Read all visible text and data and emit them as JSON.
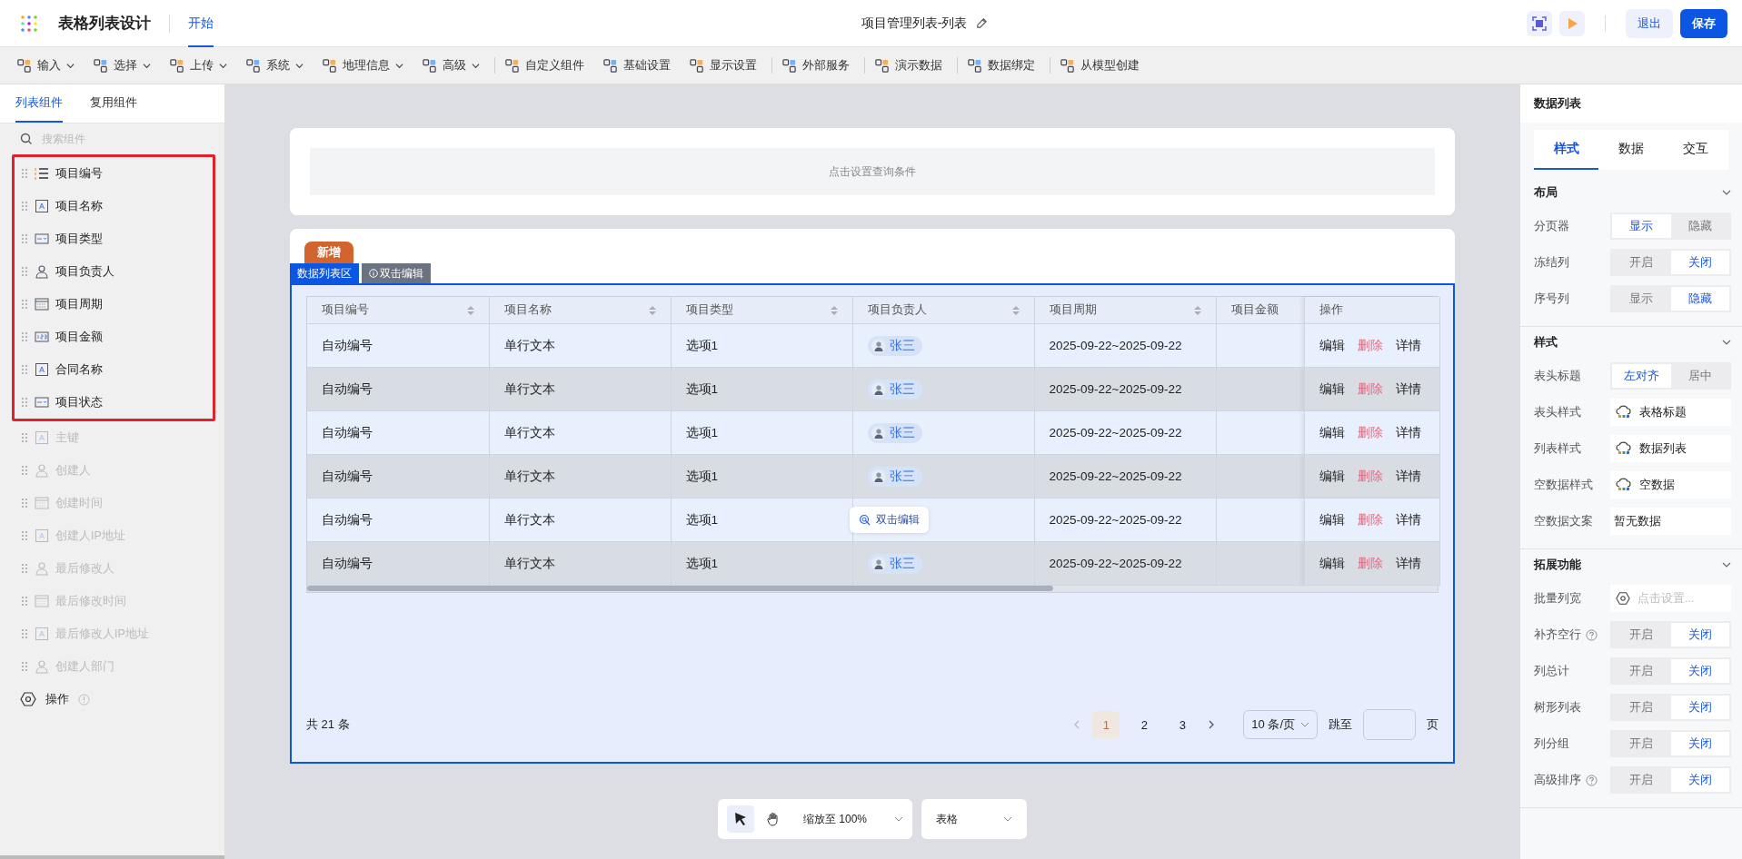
{
  "header": {
    "app_title": "表格列表设计",
    "tabs": [
      {
        "label": "开始",
        "selected": true
      }
    ],
    "doc_title": "项目管理列表-列表",
    "buttons": [
      {
        "label": "退出",
        "kind": "secondary"
      },
      {
        "label": "保存",
        "kind": "primary"
      }
    ]
  },
  "toolbar": [
    {
      "label": "输入",
      "dropdown": true,
      "divider": false
    },
    {
      "label": "选择",
      "dropdown": true,
      "divider": false
    },
    {
      "label": "上传",
      "dropdown": true,
      "divider": false
    },
    {
      "label": "系统",
      "dropdown": true,
      "divider": false
    },
    {
      "label": "地理信息",
      "dropdown": true,
      "divider": false
    },
    {
      "label": "高级",
      "dropdown": true,
      "divider": false
    },
    {
      "label": "自定义组件",
      "dropdown": false,
      "divider": true
    },
    {
      "label": "基础设置",
      "dropdown": false,
      "divider": false
    },
    {
      "label": "显示设置",
      "dropdown": false,
      "divider": false
    },
    {
      "label": "外部服务",
      "dropdown": false,
      "divider": true
    },
    {
      "label": "演示数据",
      "dropdown": false,
      "divider": true
    },
    {
      "label": "数据绑定",
      "dropdown": false,
      "divider": true
    },
    {
      "label": "从模型创建",
      "dropdown": false,
      "divider": true
    }
  ],
  "sidebar": {
    "tabs": [
      {
        "label": "列表组件",
        "selected": true
      },
      {
        "label": "复用组件",
        "selected": false
      }
    ],
    "search": {
      "placeholder": "搜索组件"
    },
    "groups": [
      {
        "highlighted": true,
        "items": [
          {
            "label": "项目编号",
            "kind": "number",
            "disabled": false
          },
          {
            "label": "项目名称",
            "kind": "text",
            "disabled": false
          },
          {
            "label": "项目类型",
            "kind": "select",
            "disabled": false
          },
          {
            "label": "项目负责人",
            "kind": "user",
            "disabled": false
          },
          {
            "label": "项目周期",
            "kind": "date",
            "disabled": false
          },
          {
            "label": "项目金额",
            "kind": "amount",
            "disabled": false
          },
          {
            "label": "合同名称",
            "kind": "text",
            "disabled": false
          },
          {
            "label": "项目状态",
            "kind": "select",
            "disabled": false
          }
        ]
      },
      {
        "highlighted": false,
        "items": [
          {
            "label": "主键",
            "kind": "text",
            "disabled": true
          },
          {
            "label": "创建人",
            "kind": "user",
            "disabled": true
          },
          {
            "label": "创建时间",
            "kind": "date",
            "disabled": true
          },
          {
            "label": "创建人IP地址",
            "kind": "text",
            "disabled": true
          },
          {
            "label": "最后修改人",
            "kind": "user",
            "disabled": true
          },
          {
            "label": "最后修改时间",
            "kind": "date",
            "disabled": true
          },
          {
            "label": "最后修改人IP地址",
            "kind": "text",
            "disabled": true
          },
          {
            "label": "创建人部门",
            "kind": "user",
            "disabled": true
          }
        ]
      }
    ],
    "action_item": {
      "label": "操作"
    }
  },
  "query_area": {
    "placeholder_text": "点击设置查询条件"
  },
  "list_area": {
    "add_button": "新增",
    "tabs": [
      {
        "label": "数据列表区",
        "selected": true
      },
      {
        "label": "双击编辑",
        "selected": false
      }
    ],
    "table": {
      "columns": [
        {
          "label": "项目编号",
          "sortable": true
        },
        {
          "label": "项目名称",
          "sortable": true
        },
        {
          "label": "项目类型",
          "sortable": true
        },
        {
          "label": "项目负责人",
          "sortable": true
        },
        {
          "label": "项目周期",
          "sortable": true
        },
        {
          "label": "项目金额",
          "sortable": false
        },
        {
          "label": "操作",
          "sortable": false
        }
      ],
      "rows": [
        {
          "id": "自动编号",
          "name": "单行文本",
          "type": "选项1",
          "owner": "张三",
          "period": "2025-09-22~2025-09-22",
          "actions": [
            {
              "label": "编辑",
              "kind": "normal"
            },
            {
              "label": "删除",
              "kind": "danger"
            },
            {
              "label": "详情",
              "kind": "normal"
            }
          ]
        },
        {
          "id": "自动编号",
          "name": "单行文本",
          "type": "选项1",
          "owner": "张三",
          "period": "2025-09-22~2025-09-22",
          "actions": [
            {
              "label": "编辑",
              "kind": "normal"
            },
            {
              "label": "删除",
              "kind": "danger"
            },
            {
              "label": "详情",
              "kind": "normal"
            }
          ]
        },
        {
          "id": "自动编号",
          "name": "单行文本",
          "type": "选项1",
          "owner": "张三",
          "period": "2025-09-22~2025-09-22",
          "actions": [
            {
              "label": "编辑",
              "kind": "normal"
            },
            {
              "label": "删除",
              "kind": "danger"
            },
            {
              "label": "详情",
              "kind": "normal"
            }
          ]
        },
        {
          "id": "自动编号",
          "name": "单行文本",
          "type": "选项1",
          "owner": "张三",
          "period": "2025-09-22~2025-09-22",
          "actions": [
            {
              "label": "编辑",
              "kind": "normal"
            },
            {
              "label": "删除",
              "kind": "danger"
            },
            {
              "label": "详情",
              "kind": "normal"
            }
          ]
        },
        {
          "id": "自动编号",
          "name": "单行文本",
          "type": "选项1",
          "tooltip": "双击编辑",
          "period": "2025-09-22~2025-09-22",
          "actions": [
            {
              "label": "编辑",
              "kind": "normal"
            },
            {
              "label": "删除",
              "kind": "danger"
            },
            {
              "label": "详情",
              "kind": "normal"
            }
          ]
        },
        {
          "id": "自动编号",
          "name": "单行文本",
          "type": "选项1",
          "owner": "张三",
          "period": "2025-09-22~2025-09-22",
          "actions": [
            {
              "label": "编辑",
              "kind": "normal"
            },
            {
              "label": "删除",
              "kind": "danger"
            },
            {
              "label": "详情",
              "kind": "normal"
            }
          ]
        }
      ]
    },
    "pagination": {
      "total": "共 21 条",
      "pages": [
        {
          "label": "1",
          "selected": true
        },
        {
          "label": "2",
          "selected": false
        },
        {
          "label": "3",
          "selected": false
        }
      ],
      "page_size": "10 条/页",
      "jump_label": "跳至",
      "page_unit": "页"
    }
  },
  "bottom_bar": {
    "tools": [
      {
        "kind": "pointer",
        "selected": true
      },
      {
        "kind": "hand",
        "selected": false
      }
    ],
    "zoom": "缩放至 100%",
    "view": "表格"
  },
  "right_panel": {
    "title": "数据列表",
    "tabs": [
      {
        "label": "样式",
        "selected": true
      },
      {
        "label": "数据",
        "selected": false
      },
      {
        "label": "交互",
        "selected": false
      }
    ],
    "sections": [
      {
        "title": "布局",
        "rows": [
          {
            "label": "分页器",
            "kind": "segment",
            "help": false,
            "options": [
              {
                "label": "显示",
                "selected": true
              },
              {
                "label": "隐藏",
                "selected": false
              }
            ]
          },
          {
            "label": "冻结列",
            "kind": "segment",
            "help": false,
            "options": [
              {
                "label": "开启",
                "selected": false
              },
              {
                "label": "关闭",
                "selected": true
              }
            ]
          },
          {
            "label": "序号列",
            "kind": "segment",
            "help": false,
            "options": [
              {
                "label": "显示",
                "selected": false
              },
              {
                "label": "隐藏",
                "selected": true
              }
            ]
          }
        ]
      },
      {
        "title": "样式",
        "rows": [
          {
            "label": "表头标题",
            "kind": "segment",
            "help": false,
            "options": [
              {
                "label": "左对齐",
                "selected": true
              },
              {
                "label": "居中",
                "selected": false
              }
            ]
          },
          {
            "label": "表头样式",
            "kind": "style",
            "help": false,
            "value": "表格标题"
          },
          {
            "label": "列表样式",
            "kind": "style",
            "help": false,
            "value": "数据列表"
          },
          {
            "label": "空数据样式",
            "kind": "style",
            "help": false,
            "value": "空数据"
          },
          {
            "label": "空数据文案",
            "kind": "input",
            "help": false,
            "value": "暂无数据"
          }
        ]
      },
      {
        "title": "拓展功能",
        "rows": [
          {
            "label": "批量列宽",
            "kind": "setting",
            "help": false,
            "placeholder": "点击设置..."
          },
          {
            "label": "补齐空行",
            "kind": "segment",
            "help": true,
            "options": [
              {
                "label": "开启",
                "selected": false
              },
              {
                "label": "关闭",
                "selected": true
              }
            ]
          },
          {
            "label": "列总计",
            "kind": "segment",
            "help": false,
            "options": [
              {
                "label": "开启",
                "selected": false
              },
              {
                "label": "关闭",
                "selected": true
              }
            ]
          },
          {
            "label": "树形列表",
            "kind": "segment",
            "help": false,
            "options": [
              {
                "label": "开启",
                "selected": false
              },
              {
                "label": "关闭",
                "selected": true
              }
            ]
          },
          {
            "label": "列分组",
            "kind": "segment",
            "help": false,
            "options": [
              {
                "label": "开启",
                "selected": false
              },
              {
                "label": "关闭",
                "selected": true
              }
            ]
          },
          {
            "label": "高级排序",
            "kind": "segment",
            "help": true,
            "options": [
              {
                "label": "开启",
                "selected": false
              },
              {
                "label": "关闭",
                "selected": true
              }
            ]
          }
        ]
      }
    ]
  }
}
